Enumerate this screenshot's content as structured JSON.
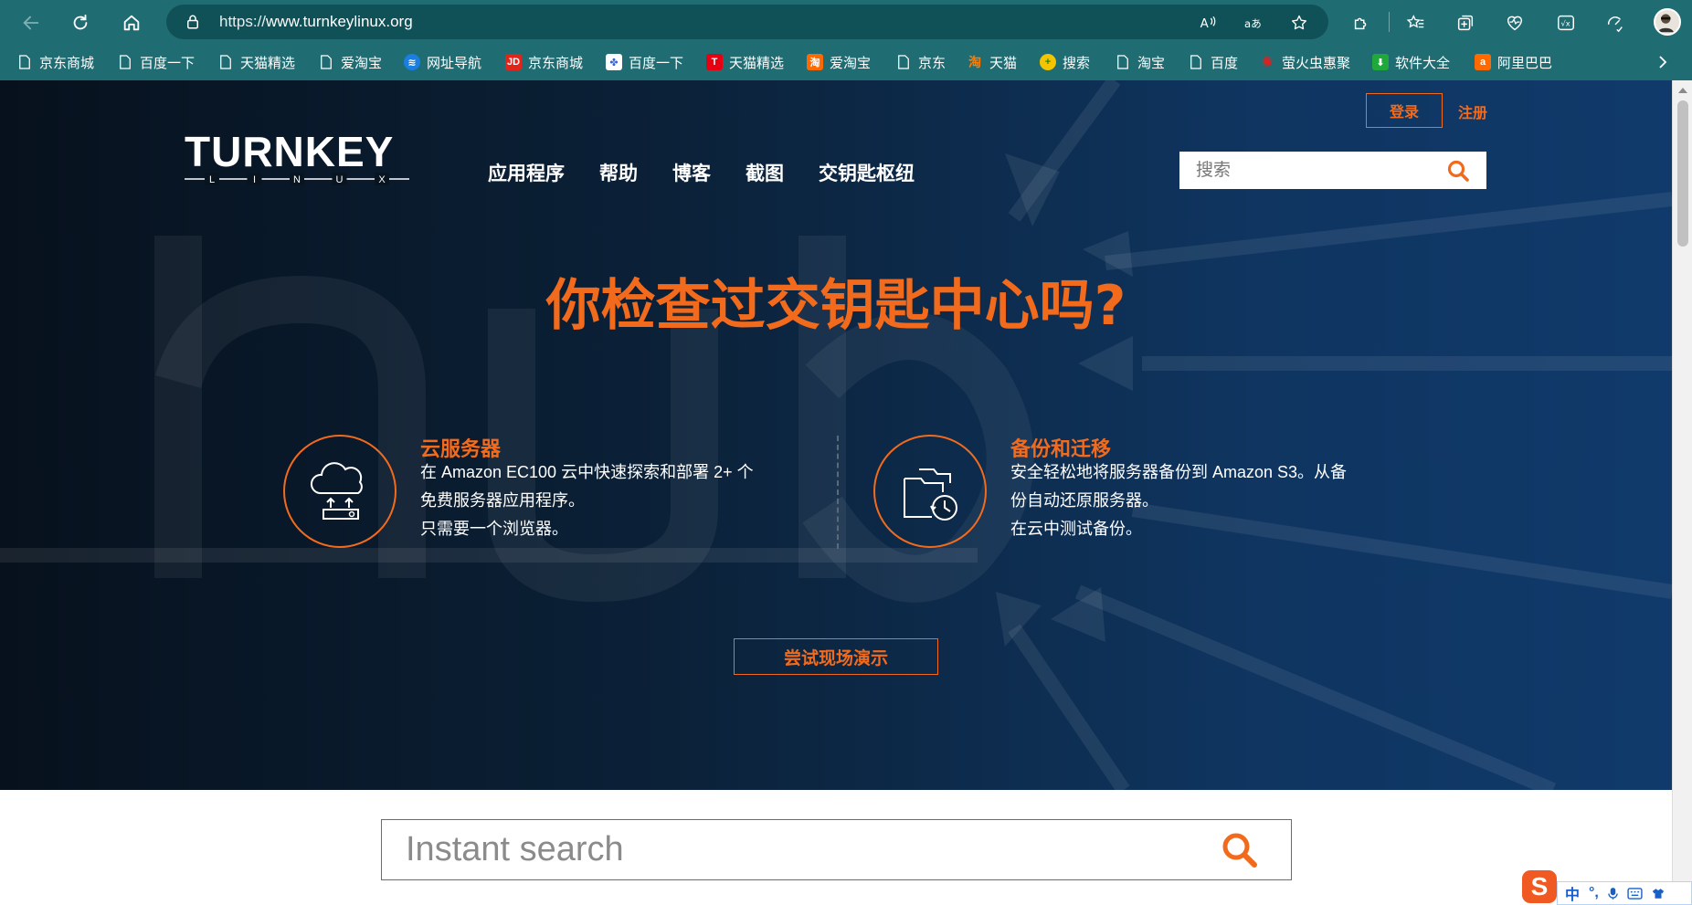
{
  "browser": {
    "url_prefix": "https://",
    "url_domain": "www.turnkeylinux.org",
    "bookmarks": [
      {
        "label": "京东商城",
        "icon": "page-icon"
      },
      {
        "label": "百度一下",
        "icon": "page-icon"
      },
      {
        "label": "天猫精选",
        "icon": "page-icon"
      },
      {
        "label": "爱淘宝",
        "icon": "page-icon"
      },
      {
        "label": "网址导航",
        "icon": "wifi-icon"
      },
      {
        "label": "京东商城",
        "icon": "jd-icon"
      },
      {
        "label": "百度一下",
        "icon": "baidu-icon"
      },
      {
        "label": "天猫精选",
        "icon": "tmall-icon"
      },
      {
        "label": "爱淘宝",
        "icon": "aitaobao-icon"
      },
      {
        "label": "京东",
        "icon": "page-icon"
      },
      {
        "label": "天猫",
        "icon": "taobao-icon"
      },
      {
        "label": "搜索",
        "icon": "search-plus-icon"
      },
      {
        "label": "淘宝",
        "icon": "page-icon"
      },
      {
        "label": "百度",
        "icon": "page-icon"
      },
      {
        "label": "萤火虫惠聚",
        "icon": "firefly-icon"
      },
      {
        "label": "软件大全",
        "icon": "download-icon"
      },
      {
        "label": "阿里巴巴",
        "icon": "alibaba-icon"
      }
    ]
  },
  "header": {
    "login": "登录",
    "register": "注册",
    "logo_text": "TURNKEY",
    "logo_sub": "LINUX",
    "nav": [
      "应用程序",
      "帮助",
      "博客",
      "截图",
      "交钥匙枢纽"
    ],
    "search_placeholder": "搜索"
  },
  "hero": {
    "headline": "你检查过交钥匙中心吗?",
    "features": [
      {
        "title": "云服务器",
        "lines": [
          "在 Amazon EC100 云中快速探索和部署 2+ 个",
          "免费服务器应用程序。",
          "只需要一个浏览器。"
        ],
        "icon": "cloud-server-icon"
      },
      {
        "title": "备份和迁移",
        "lines": [
          "安全轻松地将服务器备份到 Amazon S3。从备",
          "份自动还原服务器。",
          "在云中测试备份。"
        ],
        "icon": "backup-folder-icon"
      }
    ],
    "demo_button": "尝试现场演示"
  },
  "instant_search": {
    "placeholder": "Instant search"
  },
  "ime": {
    "logo": "S",
    "lang": "中",
    "punct": "°,"
  },
  "colors": {
    "accent": "#f26b1d",
    "chrome": "#1f6d73",
    "address_bar": "#0f5156"
  }
}
